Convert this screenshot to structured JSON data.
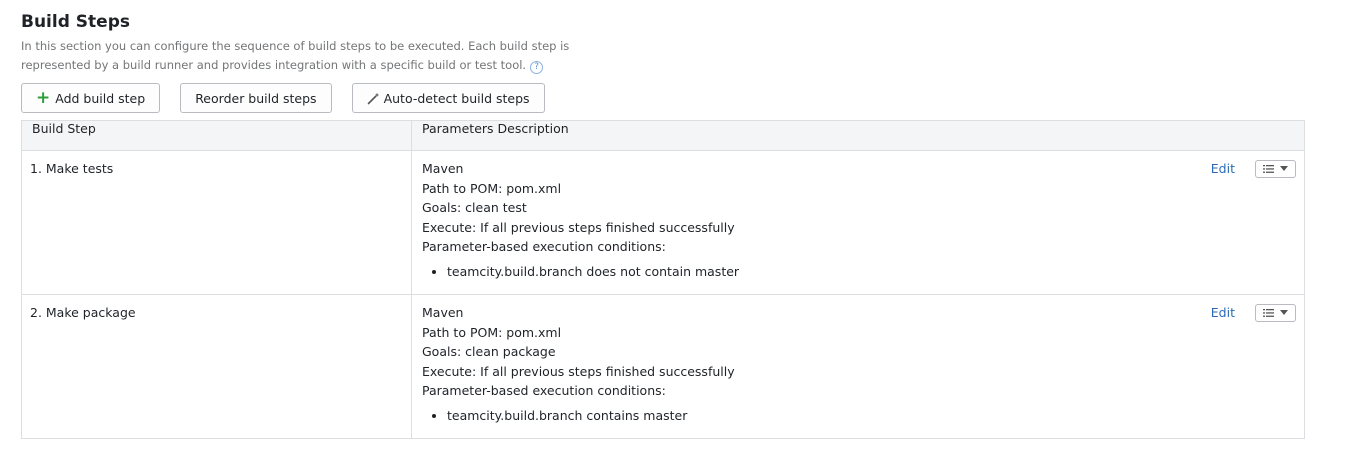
{
  "header": {
    "title": "Build Steps",
    "description": "In this section you can configure the sequence of build steps to be executed. Each build step is represented by a build runner and provides integration with a specific build or test tool.",
    "help_icon": "?"
  },
  "toolbar": {
    "add_label": "Add build step",
    "reorder_label": "Reorder build steps",
    "autodetect_label": "Auto-detect build steps",
    "add_icon": "+",
    "autodetect_icon": "magic-wand-icon"
  },
  "table": {
    "headers": [
      "Build Step",
      "Parameters Description"
    ],
    "rows": [
      {
        "step": "1. Make tests",
        "runner": "Maven",
        "pom": "Path to POM: pom.xml",
        "goals": "Goals: clean test",
        "execute": "Execute: If all previous steps finished successfully",
        "conditions_label": "Parameter-based execution conditions:",
        "conditions": [
          "teamcity.build.branch does not contain master"
        ],
        "edit_label": "Edit"
      },
      {
        "step": "2. Make package",
        "runner": "Maven",
        "pom": "Path to POM: pom.xml",
        "goals": "Goals: clean package",
        "execute": "Execute: If all previous steps finished successfully",
        "conditions_label": "Parameter-based execution conditions:",
        "conditions": [
          "teamcity.build.branch contains master"
        ],
        "edit_label": "Edit"
      }
    ]
  }
}
